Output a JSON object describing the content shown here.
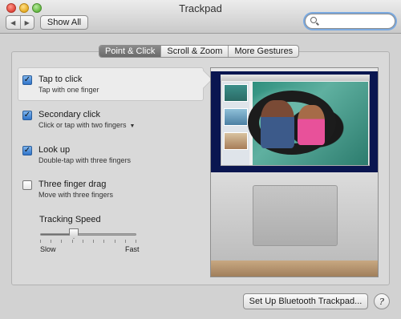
{
  "window": {
    "title": "Trackpad",
    "show_all_label": "Show All",
    "nav_back_icon": "◀",
    "nav_forward_icon": "▶",
    "search_value": ""
  },
  "tabs": [
    {
      "label": "Point & Click",
      "active": true
    },
    {
      "label": "Scroll & Zoom",
      "active": false
    },
    {
      "label": "More Gestures",
      "active": false
    }
  ],
  "options": [
    {
      "title": "Tap to click",
      "subtitle": "Tap with one finger",
      "checked": true
    },
    {
      "title": "Secondary click",
      "subtitle": "Click or tap with two fingers",
      "checked": true,
      "has_dropdown": true
    },
    {
      "title": "Look up",
      "subtitle": "Double-tap with three fingers",
      "checked": true
    },
    {
      "title": "Three finger drag",
      "subtitle": "Move with three fingers",
      "checked": false
    }
  ],
  "tracking_speed": {
    "label": "Tracking Speed",
    "min_label": "Slow",
    "max_label": "Fast",
    "level": 0.35,
    "tick_count": 10
  },
  "footer": {
    "bluetooth_button_label": "Set Up Bluetooth Trackpad...",
    "help_label": "?"
  },
  "colors": {
    "checkbox_checked": "#2f73c9",
    "active_tab": "#6b6b6b",
    "search_focus_ring": "#7aa9e0"
  }
}
